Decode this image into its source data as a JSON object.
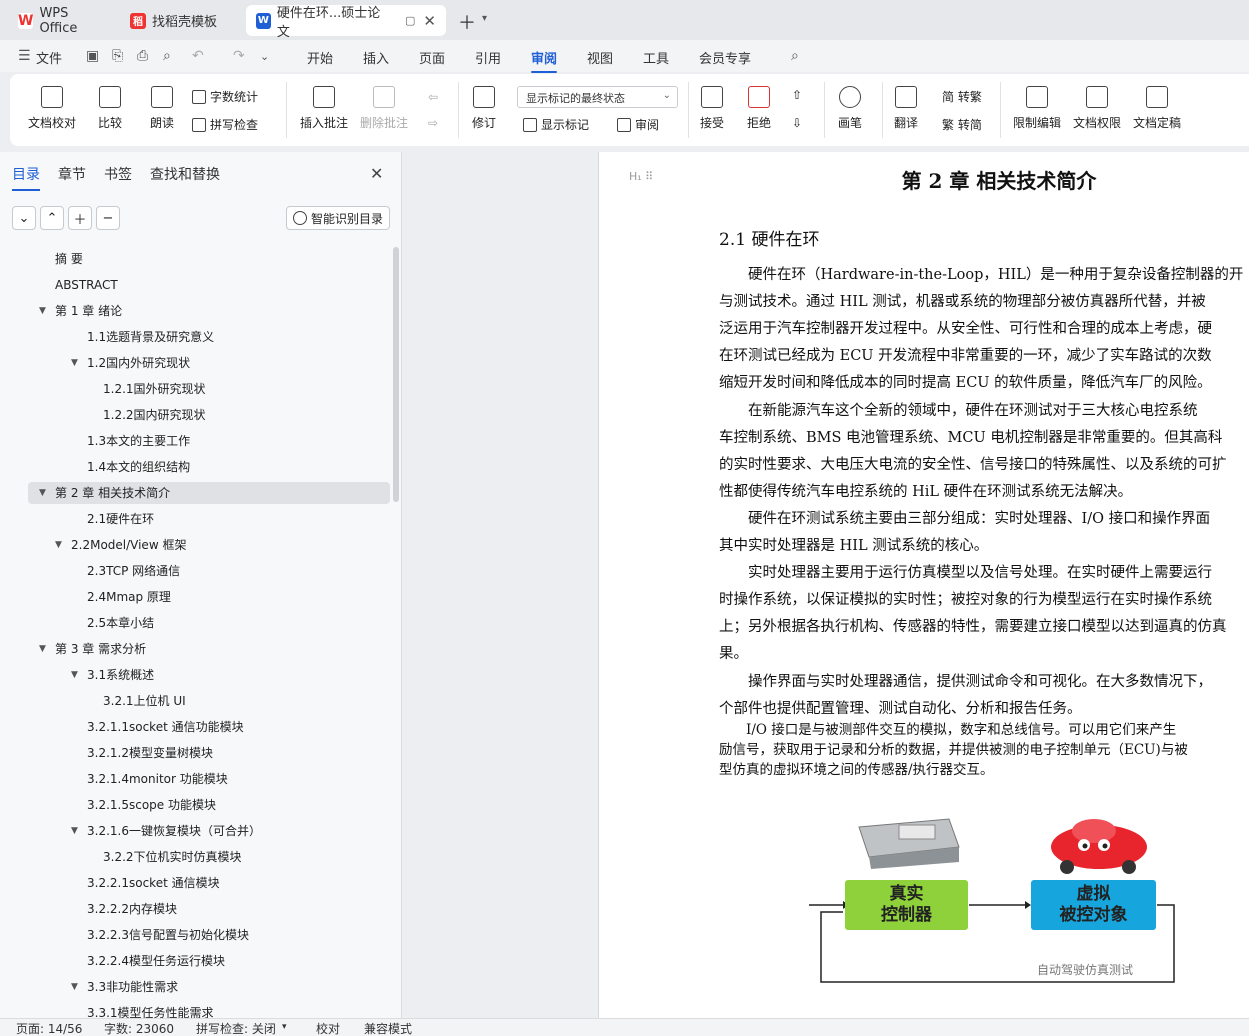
{
  "tabs": {
    "wps": "WPS Office",
    "template": "找稻壳模板",
    "document": "硬件在环...硕士论文"
  },
  "menu": {
    "file": "文件",
    "items": [
      "开始",
      "插入",
      "页面",
      "引用",
      "审阅",
      "视图",
      "工具",
      "会员专享"
    ],
    "active": "审阅"
  },
  "ribbon": {
    "doc_check": "文档校对",
    "compare": "比较",
    "read_aloud": "朗读",
    "word_count": "字数统计",
    "spell_check": "拼写检查",
    "insert_comment": "插入批注",
    "delete_comment": "删除批注",
    "revise": "修订",
    "markup_state": "显示标记的最终状态",
    "show_markup": "显示标记",
    "review": "审阅",
    "accept": "接受",
    "reject": "拒绝",
    "pen": "画笔",
    "translate": "翻译",
    "to_traditional": "简 转繁",
    "to_simplified": "繁 转简",
    "restrict_edit": "限制编辑",
    "doc_permission": "文档权限",
    "doc_finalize": "文档定稿"
  },
  "nav": {
    "tabs": [
      "目录",
      "章节",
      "书签",
      "查找和替换"
    ],
    "active_tab": "目录",
    "smart_toc": "智能识别目录",
    "toc": [
      {
        "text": "摘 要",
        "level": 1,
        "arrow": ""
      },
      {
        "text": "ABSTRACT",
        "level": 1,
        "arrow": ""
      },
      {
        "text": "第 1 章 绪论",
        "level": 1,
        "arrow": "down"
      },
      {
        "text": "1.1选题背景及研究意义",
        "level": 3,
        "arrow": ""
      },
      {
        "text": "1.2国内外研究现状",
        "level": 3,
        "arrow": "down"
      },
      {
        "text": "1.2.1国外研究现状",
        "level": 4,
        "arrow": ""
      },
      {
        "text": "1.2.2国内研究现状",
        "level": 4,
        "arrow": ""
      },
      {
        "text": "1.3本文的主要工作",
        "level": 3,
        "arrow": ""
      },
      {
        "text": "1.4本文的组织结构",
        "level": 3,
        "arrow": ""
      },
      {
        "text": "第 2 章 相关技术简介",
        "level": 1,
        "arrow": "down",
        "selected": true
      },
      {
        "text": "2.1硬件在环",
        "level": 3,
        "arrow": ""
      },
      {
        "text": "2.2Model/View 框架",
        "level": 2,
        "arrow": "down"
      },
      {
        "text": "2.3TCP 网络通信",
        "level": 3,
        "arrow": ""
      },
      {
        "text": "2.4Mmap 原理",
        "level": 3,
        "arrow": ""
      },
      {
        "text": "2.5本章小结",
        "level": 3,
        "arrow": ""
      },
      {
        "text": "第 3 章 需求分析",
        "level": 1,
        "arrow": "down"
      },
      {
        "text": "3.1系统概述",
        "level": 3,
        "arrow": "down"
      },
      {
        "text": "3.2.1上位机 UI",
        "level": 4,
        "arrow": ""
      },
      {
        "text": "3.2.1.1socket 通信功能模块",
        "level": 3,
        "arrow": ""
      },
      {
        "text": "3.2.1.2模型变量树模块",
        "level": 3,
        "arrow": ""
      },
      {
        "text": "3.2.1.4monitor 功能模块",
        "level": 3,
        "arrow": ""
      },
      {
        "text": "3.2.1.5scope 功能模块",
        "level": 3,
        "arrow": ""
      },
      {
        "text": "3.2.1.6一键恢复模块（可合并）",
        "level": 3,
        "arrow": "down"
      },
      {
        "text": "3.2.2下位机实时仿真模块",
        "level": 4,
        "arrow": ""
      },
      {
        "text": "3.2.2.1socket 通信模块",
        "level": 3,
        "arrow": ""
      },
      {
        "text": "3.2.2.2内存模块",
        "level": 3,
        "arrow": ""
      },
      {
        "text": "3.2.2.3信号配置与初始化模块",
        "level": 3,
        "arrow": ""
      },
      {
        "text": "3.2.2.4模型任务运行模块",
        "level": 3,
        "arrow": ""
      },
      {
        "text": "3.3非功能性需求",
        "level": 3,
        "arrow": "down"
      },
      {
        "text": "3.3.1模型任务性能需求",
        "level": 3,
        "arrow": ""
      }
    ]
  },
  "document": {
    "chapter_title": "第 2 章  相关技术简介",
    "section_title": "2.1  硬件在环",
    "lines": [
      "　　硬件在环（Hardware-in-the-Loop，HIL）是一种用于复杂设备控制器的开",
      "与测试技术。通过 HIL 测试，机器或系统的物理部分被仿真器所代替，并被",
      "泛运用于汽车控制器开发过程中。从安全性、可行性和合理的成本上考虑，硬",
      "在环测试已经成为 ECU 开发流程中非常重要的一环，减少了实车路试的次数",
      "缩短开发时间和降低成本的同时提高 ECU 的软件质量，降低汽车厂的风险。",
      "　　在新能源汽车这个全新的领域中，硬件在环测试对于三大核心电控系统",
      "车控制系统、BMS 电池管理系统、MCU 电机控制器是非常重要的。但其高科",
      "的实时性要求、大电压大电流的安全性、信号接口的特殊属性、以及系统的可扩",
      "性都使得传统汽车电控系统的 HiL 硬件在环测试系统无法解决。",
      "　　硬件在环测试系统主要由三部分组成：实时处理器、I/O 接口和操作界面",
      "其中实时处理器是 HIL 测试系统的核心。",
      "　　实时处理器主要用于运行仿真模型以及信号处理。在实时硬件上需要运行",
      "时操作系统，以保证模拟的实时性；被控对象的行为模型运行在实时操作系统",
      "上；另外根据各执行机构、传感器的特性，需要建立接口模型以达到逼真的仿真",
      "果。",
      "　　操作界面与实时处理器通信，提供测试命令和可视化。在大多数情况下，",
      "个部件也提供配置管理、测试自动化、分析和报告任务。"
    ],
    "small_lines": [
      "　　I/O 接口是与被测部件交互的模拟，数字和总线信号。可以用它们来产生",
      "励信号，获取用于记录和分析的数据，并提供被测的电子控制单元（ECU)与被",
      "型仿真的虚拟环境之间的传感器/执行器交互。"
    ],
    "figure": {
      "box_left": "真实\n控制器",
      "box_right": "虚拟\n被控对象",
      "watermark": "自动驾驶仿真测试"
    }
  },
  "status": {
    "page": "页面: 14/56",
    "words": "字数: 23060",
    "spell": "拼写检查: 关闭",
    "proof": "校对",
    "compat": "兼容模式"
  },
  "colors": {
    "accent": "#1f5fd6",
    "fig_green": "#8ed13a",
    "fig_blue": "#16a6dd"
  }
}
